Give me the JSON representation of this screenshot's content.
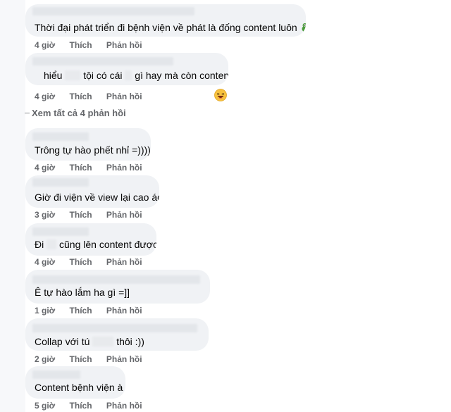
{
  "comments": [
    {
      "text": "Thời đại phát triển đi bệnh viện về phát là đống content luôn",
      "time": "4 giờ"
    },
    {
      "text_a": "hiểu",
      "text_b": "tội có cái",
      "text_c": "gì hay mà còn content :))",
      "time": "4 giờ"
    },
    {
      "text": "Trông tự hào phết nhỉ =))))",
      "time": "4 giờ"
    },
    {
      "text": "Giờ đi viện về view lại cao ác",
      "time": "3 giờ"
    },
    {
      "text_a": "Đi",
      "text_b": "cũng lên content được",
      "time": "4 giờ"
    },
    {
      "text": "Ê tự hào lắm ha gì =]]",
      "time": "1 giờ"
    },
    {
      "text_a": "Collap với tú",
      "text_b": "thôi :))",
      "time": "2 giờ"
    },
    {
      "text": "Content bệnh viện à",
      "time": "5 giờ"
    }
  ],
  "actions": {
    "like": "Thích",
    "reply": "Phản hồi"
  },
  "see_more": "Xem tất cả 4 phản hồi",
  "colors": {
    "bubble": "#f0f2f5",
    "meta": "#65676b",
    "text": "#050505"
  },
  "icons": [
    "frog-emoji-icon",
    "laughing-emoji-icon"
  ]
}
